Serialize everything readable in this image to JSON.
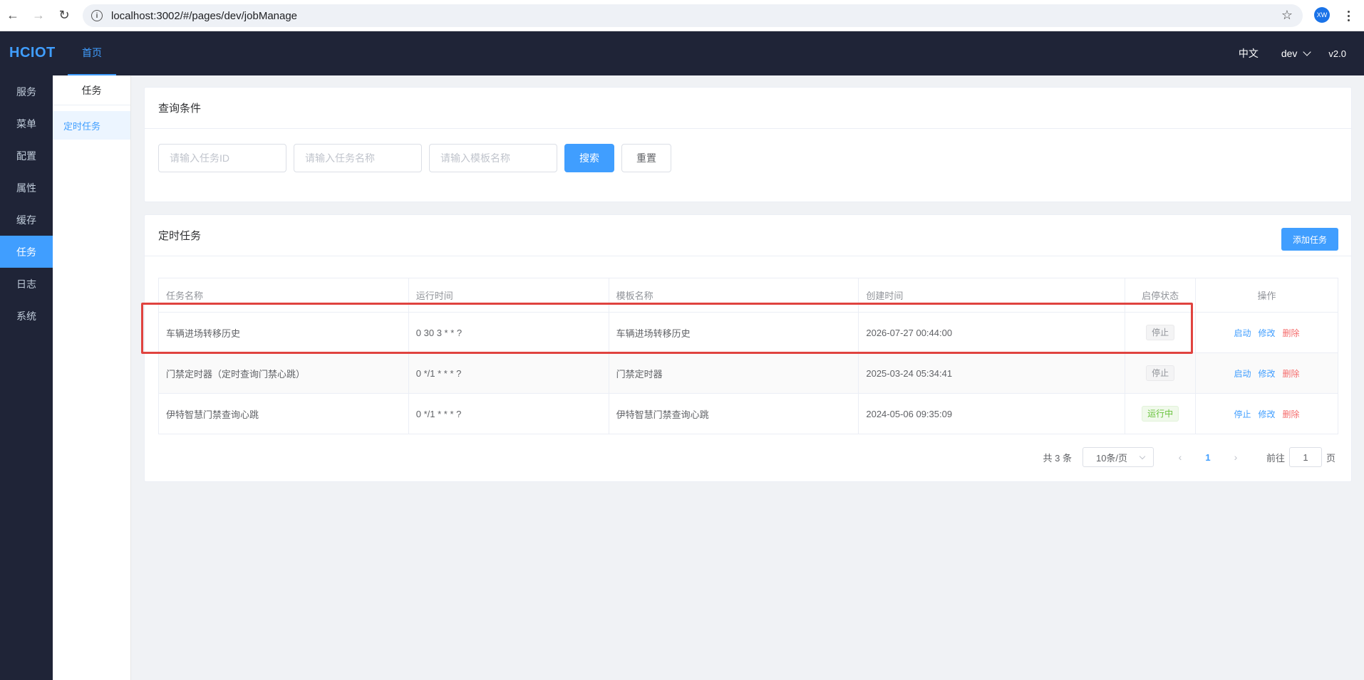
{
  "browser": {
    "url": "localhost:3002/#/pages/dev/jobManage",
    "avatar_text": "XW"
  },
  "header": {
    "logo": "HCIOT",
    "nav_home": "首页",
    "language": "中文",
    "user": "dev",
    "version": "v2.0"
  },
  "sidebar": {
    "items": [
      {
        "label": "服务"
      },
      {
        "label": "菜单"
      },
      {
        "label": "配置"
      },
      {
        "label": "属性"
      },
      {
        "label": "缓存"
      },
      {
        "label": "任务"
      },
      {
        "label": "日志"
      },
      {
        "label": "系统"
      }
    ],
    "active": "任务"
  },
  "subnav": {
    "title": "任务",
    "item": "定时任务"
  },
  "query": {
    "title": "查询条件",
    "id_placeholder": "请输入任务ID",
    "name_placeholder": "请输入任务名称",
    "template_placeholder": "请输入模板名称",
    "search_label": "搜索",
    "reset_label": "重置"
  },
  "jobs": {
    "title": "定时任务",
    "add_label": "添加任务",
    "columns": [
      "任务名称",
      "运行时间",
      "模板名称",
      "创建时间",
      "启停状态",
      "操作"
    ],
    "rows": [
      {
        "name": "车辆进场转移历史",
        "cron": "0 30 3 * * ?",
        "template": "车辆进场转移历史",
        "created": "2026-07-27 00:44:00",
        "status": "停止",
        "action1": "启动",
        "action2": "修改",
        "action3": "删除"
      },
      {
        "name": "门禁定时器（定时查询门禁心跳）",
        "cron": "0 */1 * * * ?",
        "template": "门禁定时器",
        "created": "2025-03-24 05:34:41",
        "status": "停止",
        "action1": "启动",
        "action2": "修改",
        "action3": "删除"
      },
      {
        "name": "伊特智慧门禁查询心跳",
        "cron": "0 */1 * * * ?",
        "template": "伊特智慧门禁查询心跳",
        "created": "2024-05-06 09:35:09",
        "status": "运行中",
        "action1": "停止",
        "action2": "修改",
        "action3": "删除"
      }
    ]
  },
  "pagination": {
    "total": "共 3 条",
    "page_size": "10条/页",
    "current_page": "1",
    "goto_prefix": "前往",
    "goto_value": "1",
    "goto_suffix": "页"
  },
  "colors": {
    "primary": "#409eff",
    "danger": "#f56c6c",
    "success": "#67c23a",
    "nav_bg": "#1f2437",
    "highlight": "#e0433f"
  }
}
